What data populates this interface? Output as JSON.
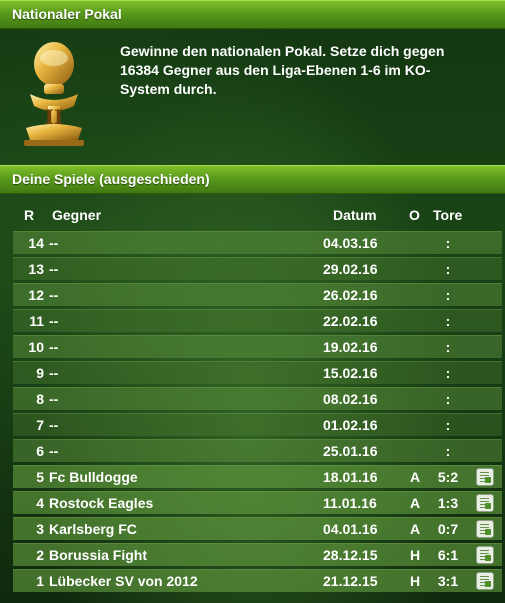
{
  "section_cup": {
    "title": "Nationaler Pokal",
    "description_lines": [
      "Gewinne den nationalen Pokal. Setze dich gegen",
      "16384 Gegner aus den Liga-Ebenen 1-6 im KO-",
      "System durch."
    ],
    "trophy_icon": "trophy-icon"
  },
  "section_games": {
    "title": "Deine Spiele (ausgeschieden)",
    "columns": {
      "round": "R",
      "opponent": "Gegner",
      "date": "Datum",
      "location": "O",
      "goals": "Tore"
    },
    "rows": [
      {
        "round": "14",
        "opponent": "--",
        "date": "04.03.16",
        "location": "",
        "result": ":"
      },
      {
        "round": "13",
        "opponent": "--",
        "date": "29.02.16",
        "location": "",
        "result": ":"
      },
      {
        "round": "12",
        "opponent": "--",
        "date": "26.02.16",
        "location": "",
        "result": ":"
      },
      {
        "round": "11",
        "opponent": "--",
        "date": "22.02.16",
        "location": "",
        "result": ":"
      },
      {
        "round": "10",
        "opponent": "--",
        "date": "19.02.16",
        "location": "",
        "result": ":"
      },
      {
        "round": "9",
        "opponent": "--",
        "date": "15.02.16",
        "location": "",
        "result": ":"
      },
      {
        "round": "8",
        "opponent": "--",
        "date": "08.02.16",
        "location": "",
        "result": ":"
      },
      {
        "round": "7",
        "opponent": "--",
        "date": "01.02.16",
        "location": "",
        "result": ":"
      },
      {
        "round": "6",
        "opponent": "--",
        "date": "25.01.16",
        "location": "",
        "result": ":"
      },
      {
        "round": "5",
        "opponent": "Fc Bulldogge",
        "date": "18.01.16",
        "location": "A",
        "result": "5:2"
      },
      {
        "round": "4",
        "opponent": "Rostock Eagles",
        "date": "11.01.16",
        "location": "A",
        "result": "1:3"
      },
      {
        "round": "3",
        "opponent": "Karlsberg FC",
        "date": "04.01.16",
        "location": "A",
        "result": "0:7"
      },
      {
        "round": "2",
        "opponent": "Borussia Fight",
        "date": "28.12.15",
        "location": "H",
        "result": "6:1"
      },
      {
        "round": "1",
        "opponent": "Lübecker SV von 2012",
        "date": "21.12.15",
        "location": "H",
        "result": "3:1"
      }
    ],
    "report_icon": "match-report-icon"
  }
}
